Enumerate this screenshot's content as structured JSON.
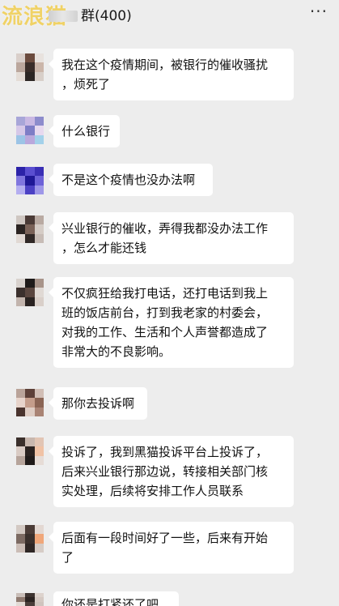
{
  "header": {
    "watermark": "流浪猫",
    "group_title": "群(400)",
    "more_label": "···"
  },
  "messages": [
    {
      "lines": [
        "我在这个疫情期间，被银行的催收骚扰",
        "，烦死了"
      ]
    },
    {
      "lines": [
        "什么银行"
      ]
    },
    {
      "lines": [
        "不是这个疫情也没办法啊"
      ]
    },
    {
      "lines": [
        "兴业银行的催收，弄得我都没办法工作",
        "，怎么才能还钱"
      ]
    },
    {
      "lines": [
        "不仅疯狂给我打电话，还打电话到我上",
        "班的饭店前台，打到我老家的村委会，",
        "对我的工作、生活和个人声誉都造成了",
        "非常大的不良影响。"
      ]
    },
    {
      "lines": [
        "那你去投诉啊"
      ]
    },
    {
      "lines": [
        "投诉了，我到黑猫投诉平台上投诉了，",
        "后来兴业银行那边说，转接相关部门核",
        "实处理，后续将安排工作人员联系"
      ]
    },
    {
      "lines": [
        "后面有一段时间好了一些，后来有开始",
        "了"
      ]
    },
    {
      "lines": [
        "你还是打紧还了吧"
      ]
    }
  ]
}
